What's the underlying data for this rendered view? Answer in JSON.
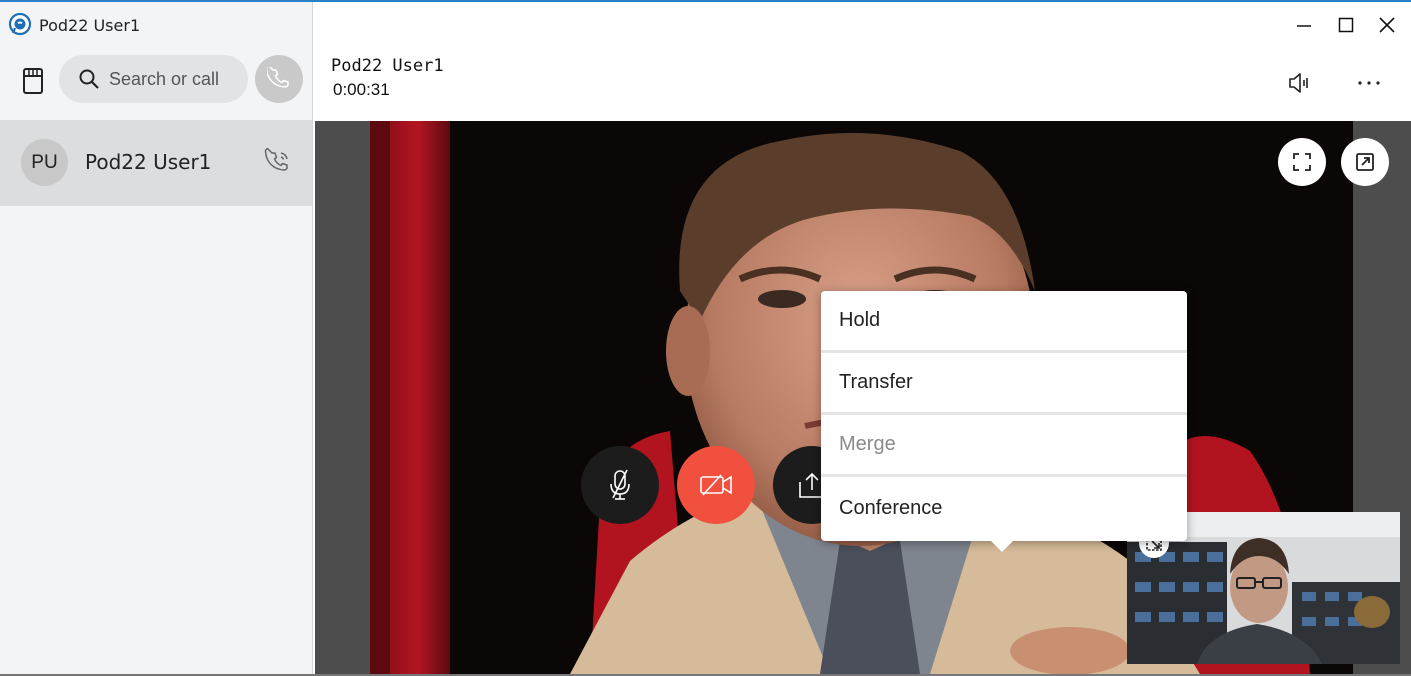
{
  "app": {
    "title": "Pod22 User1"
  },
  "search": {
    "placeholder": "Search or call"
  },
  "call_list": [
    {
      "initials": "PU",
      "name": "Pod22 User1"
    }
  ],
  "call": {
    "name": "Pod22 User1",
    "duration": "0:00:31"
  },
  "more_menu": {
    "items": [
      {
        "label": "Hold",
        "enabled": true
      },
      {
        "label": "Transfer",
        "enabled": true
      },
      {
        "label": "Merge",
        "enabled": false
      },
      {
        "label": "Conference",
        "enabled": true
      }
    ]
  },
  "controls": [
    "mute-microphone",
    "stop-video",
    "share-screen",
    "keypad",
    "more-options",
    "end-call"
  ],
  "colors": {
    "accent_red": "#f2503f",
    "control_dark": "#1c1c1c",
    "window_accent": "#2a80c8"
  }
}
